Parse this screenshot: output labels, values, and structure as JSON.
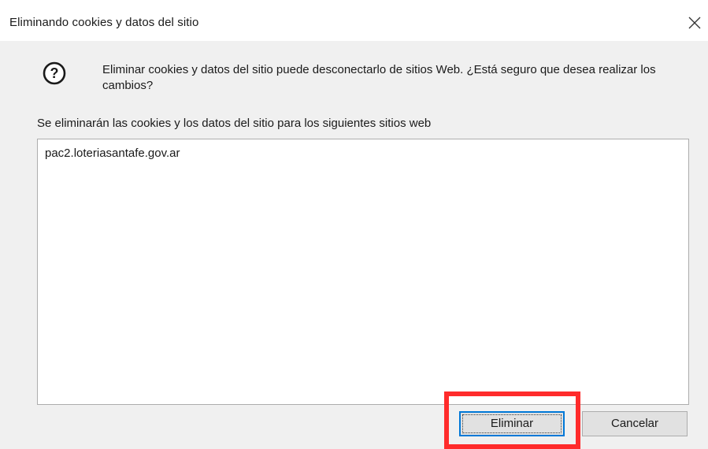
{
  "window": {
    "title": "Eliminando cookies y datos del sitio"
  },
  "dialog": {
    "icon": "question-icon",
    "message": "Eliminar cookies y datos del sitio puede desconectarlo de sitios Web. ¿Está seguro que desea realizar los cambios?",
    "list_label": "Se eliminarán las cookies y los datos del sitio para los siguientes sitios web",
    "sites": [
      "pac2.loteriasantafe.gov.ar"
    ]
  },
  "buttons": {
    "delete_label": "Eliminar",
    "cancel_label": "Cancelar"
  },
  "colors": {
    "highlight": "#ff2b2b",
    "focus_border": "#0078d7",
    "dialog_background": "#f0f0f0"
  }
}
